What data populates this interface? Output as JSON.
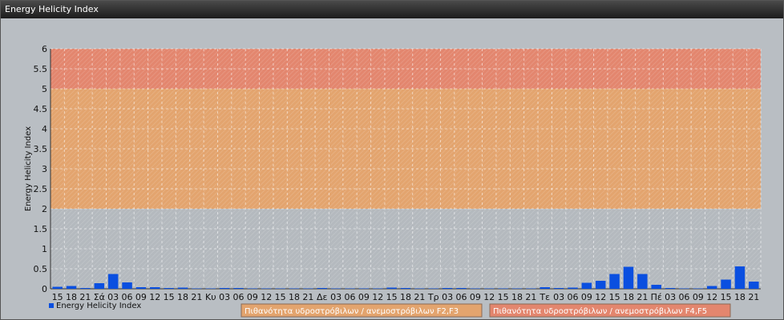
{
  "window": {
    "title": "Energy Helicity Index"
  },
  "chart_data": {
    "type": "bar",
    "title": "",
    "xlabel": "",
    "ylabel": "Energy Helicity Index",
    "ylim": [
      0,
      6
    ],
    "yticks": [
      "0",
      "0.5",
      "1",
      "1.5",
      "2",
      "2.5",
      "3",
      "3.5",
      "4",
      "4.5",
      "5",
      "5.5",
      "6"
    ],
    "grid": true,
    "categories": [
      "15",
      "18",
      "21",
      "Σά",
      "03",
      "06",
      "09",
      "12",
      "15",
      "18",
      "21",
      "Κυ",
      "03",
      "06",
      "09",
      "12",
      "15",
      "18",
      "21",
      "Δε",
      "03",
      "06",
      "09",
      "12",
      "15",
      "18",
      "21",
      "Τρ",
      "03",
      "06",
      "09",
      "12",
      "15",
      "18",
      "21",
      "Τε",
      "03",
      "06",
      "09",
      "12",
      "15",
      "18",
      "21",
      "Πέ",
      "03",
      "06",
      "09",
      "12",
      "15",
      "18",
      "21"
    ],
    "series": [
      {
        "name": "Energy Helicity Index",
        "color": "#0a4fe0",
        "values": [
          0.05,
          0.07,
          0.02,
          0.14,
          0.37,
          0.16,
          0.04,
          0.04,
          0.02,
          0.03,
          0.01,
          0.01,
          0.02,
          0.02,
          0.01,
          0.01,
          0.01,
          0.01,
          0.01,
          0.02,
          0.01,
          0.01,
          0.01,
          0.01,
          0.03,
          0.02,
          0.01,
          0.01,
          0.02,
          0.02,
          0.01,
          0.01,
          0.01,
          0.01,
          0.01,
          0.04,
          0.02,
          0.03,
          0.15,
          0.2,
          0.37,
          0.55,
          0.37,
          0.1,
          0.02,
          0.01,
          0.01,
          0.07,
          0.23,
          0.56,
          0.18
        ]
      }
    ],
    "bands": [
      {
        "from": 2,
        "to": 5,
        "color": "#e3a46e",
        "label": "Πιθανότητα υδροστρόβιλων / ανεμοστρόβιλων F2,F3"
      },
      {
        "from": 5,
        "to": 6,
        "color": "#e3866e",
        "label": "Πιθανότητα υδροστρόβιλων / ανεμοστρόβιλων F4,F5"
      }
    ],
    "legend_position": "bottom-left"
  }
}
